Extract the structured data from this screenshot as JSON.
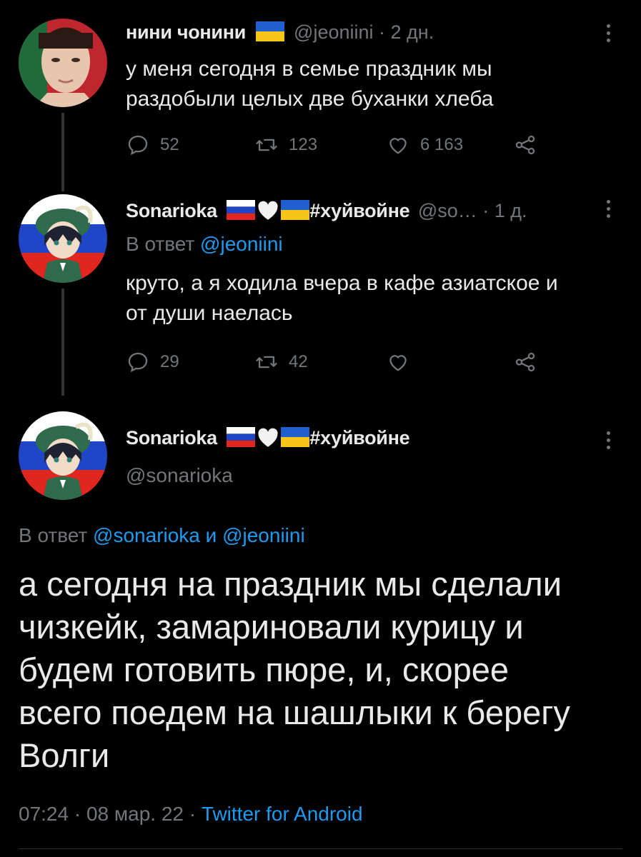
{
  "tweet1": {
    "name": "нини чонини",
    "handle": "@jeoniini",
    "time": "2 дн.",
    "text_line1": "у меня сегодня в семье праздник мы",
    "text_line2": "раздобыли целых две буханки хлеба",
    "replies": "52",
    "retweets": "123",
    "likes": "6 163"
  },
  "tweet2": {
    "name": "Sonarioka",
    "hashtag": "#хуйвойне",
    "handle": "@so…",
    "time": "1 д.",
    "reply_prefix": "В ответ",
    "reply_to": "@jeoniini",
    "text_line1": "круто, а я ходила вчера в кафе азиатское и",
    "text_line2": "от души наелась",
    "replies": "29",
    "retweets": "42"
  },
  "tweet3": {
    "name": "Sonarioka",
    "hashtag": "#хуйвойне",
    "handle": "@sonarioka",
    "reply_prefix": "В ответ",
    "reply_to_1": "@sonarioka",
    "reply_and": "и",
    "reply_to_2": "@jeoniini",
    "text_lines": [
      "а сегодня на праздник мы сделали",
      "чизкейк, замариновали курицу и",
      "будем готовить пюре, и, скорее",
      "всего поедем на шашлыки к берегу",
      "Волги"
    ],
    "time": "07:24",
    "date": "08 мар. 22",
    "source": "Twitter for Android"
  },
  "colors": {
    "background": "#000000",
    "text": "#e7e9ea",
    "muted": "#71767b",
    "link": "#1d9bf0",
    "thread_line": "#2f3336"
  }
}
